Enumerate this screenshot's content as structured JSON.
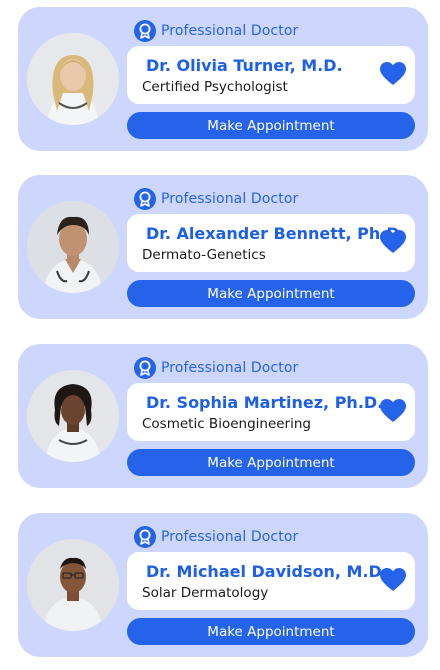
{
  "accent_color": "#2563eb",
  "card_color": "#cdd6fd",
  "doctors": [
    {
      "badge": "Professional Doctor",
      "badge_icon": "award-ribbon-icon",
      "name": "Dr. Olivia Turner, M.D.",
      "specialty": "Certified Psychologist",
      "favorite_icon": "heart-icon",
      "button": "Make Appointment"
    },
    {
      "badge": "Professional Doctor",
      "badge_icon": "award-ribbon-icon",
      "name": "Dr. Alexander Bennett, Ph.D.",
      "specialty": "Dermato-Genetics",
      "favorite_icon": "heart-icon",
      "button": "Make Appointment"
    },
    {
      "badge": "Professional Doctor",
      "badge_icon": "award-ribbon-icon",
      "name": "Dr. Sophia Martinez, Ph.D.",
      "specialty": "Cosmetic Bioengineering",
      "favorite_icon": "heart-icon",
      "button": "Make Appointment"
    },
    {
      "badge": "Professional Doctor",
      "badge_icon": "award-ribbon-icon",
      "name": "Dr. Michael Davidson, M.D.",
      "specialty": "Solar Dermatology",
      "favorite_icon": "heart-icon",
      "button": "Make Appointment"
    }
  ]
}
